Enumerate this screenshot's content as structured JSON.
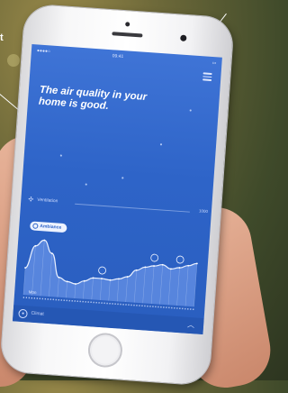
{
  "status_bar": {
    "carrier": "●●●●○",
    "time": "09:41",
    "battery": "▭"
  },
  "headline": "The air quality in your home is good.",
  "ventilation": {
    "label": "Ventilation",
    "value": "1000"
  },
  "pill": {
    "label": "Ambiance"
  },
  "chart_data": {
    "type": "area",
    "x": [
      0,
      1,
      2,
      3,
      4,
      5,
      6,
      7,
      8,
      9,
      10,
      11,
      12,
      13,
      14,
      15,
      16,
      17,
      18,
      19,
      20
    ],
    "values": [
      30,
      55,
      62,
      48,
      22,
      18,
      16,
      20,
      24,
      24,
      23,
      25,
      28,
      36,
      40,
      42,
      44,
      40,
      42,
      45,
      48
    ],
    "markers": [
      {
        "x": 9,
        "icon": "fan-icon"
      },
      {
        "x": 15,
        "icon": "window-icon"
      },
      {
        "x": 18,
        "icon": "thermometer-icon"
      }
    ],
    "ylim": [
      0,
      70
    ],
    "label": "Mon",
    "color": "#8fb3ff"
  },
  "bottom_bar": {
    "label": "Climat"
  },
  "callouts": {
    "left_text": "t"
  }
}
